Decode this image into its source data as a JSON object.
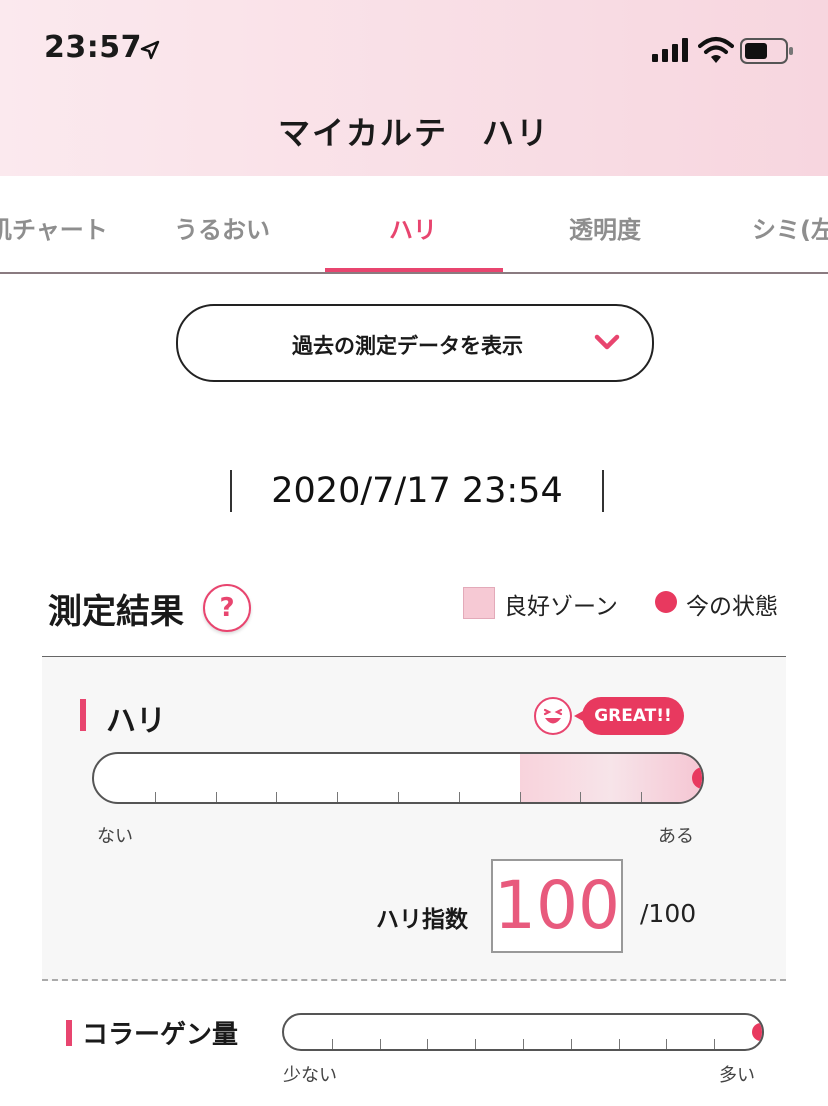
{
  "status_bar": {
    "time": "23:57"
  },
  "header": {
    "title": "マイカルテ　ハリ"
  },
  "tabs": [
    {
      "label": "肌チャート",
      "active": false
    },
    {
      "label": "うるおい",
      "active": false
    },
    {
      "label": "ハリ",
      "active": true
    },
    {
      "label": "透明度",
      "active": false
    },
    {
      "label": "シミ(左",
      "active": false
    }
  ],
  "past_data_button": {
    "label": "過去の測定データを表示"
  },
  "measurement": {
    "datetime": "2020/7/17 23:54"
  },
  "results": {
    "title": "測定結果",
    "help": "?",
    "legend_good": "良好ゾーン",
    "legend_now": "今の状態"
  },
  "hari": {
    "label": "ハリ",
    "badge": "GREAT!!",
    "gauge_value_fraction": 1.0,
    "good_zone_start_fraction": 0.7,
    "low_label": "ない",
    "high_label": "ある",
    "index_label": "ハリ指数",
    "index_value": "100",
    "index_max": "/100"
  },
  "collagen": {
    "label": "コラーゲン量",
    "gauge_value_fraction": 1.0,
    "low_label": "少ない",
    "high_label": "多い"
  },
  "colors": {
    "accent": "#e8456f",
    "good_zone": "#f6c9d4",
    "header_bg": "#f7d6df"
  }
}
